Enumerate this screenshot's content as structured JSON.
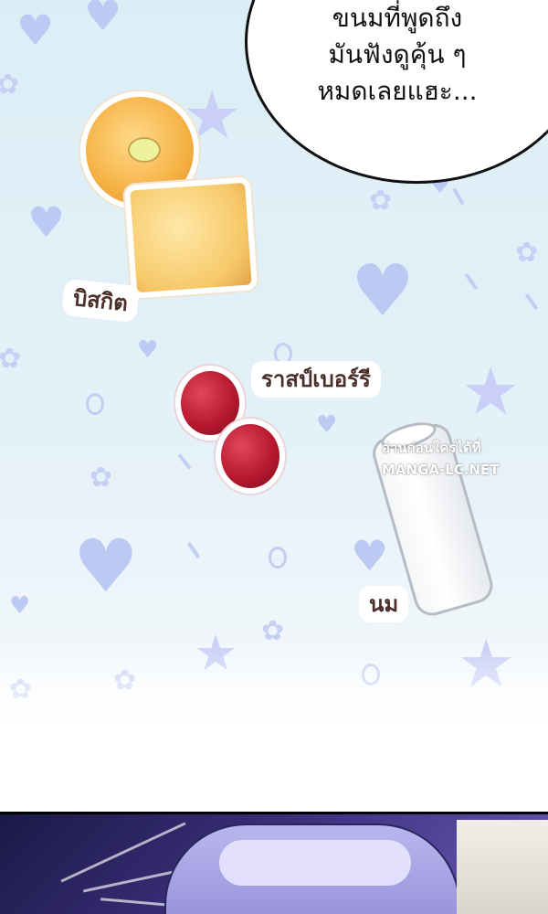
{
  "speech_bubble": {
    "lines": [
      "ขนมที่พูดถึง",
      "มันฟังดูคุ้น ๆ",
      "หมดเลยแฮะ..."
    ]
  },
  "labels": {
    "biscuit": "บิสกิต",
    "raspberry": "ราสป์เบอร์รี",
    "milk": "นม"
  },
  "watermark": {
    "lines": [
      "อ่านก่อนใครได้ที่",
      "MANGA-LC.NET"
    ]
  },
  "colors": {
    "background": "#dbeef6",
    "pattern": "#c4cdf2",
    "label_text": "#4a2f2a",
    "night_panel": "#3b2f7a"
  }
}
